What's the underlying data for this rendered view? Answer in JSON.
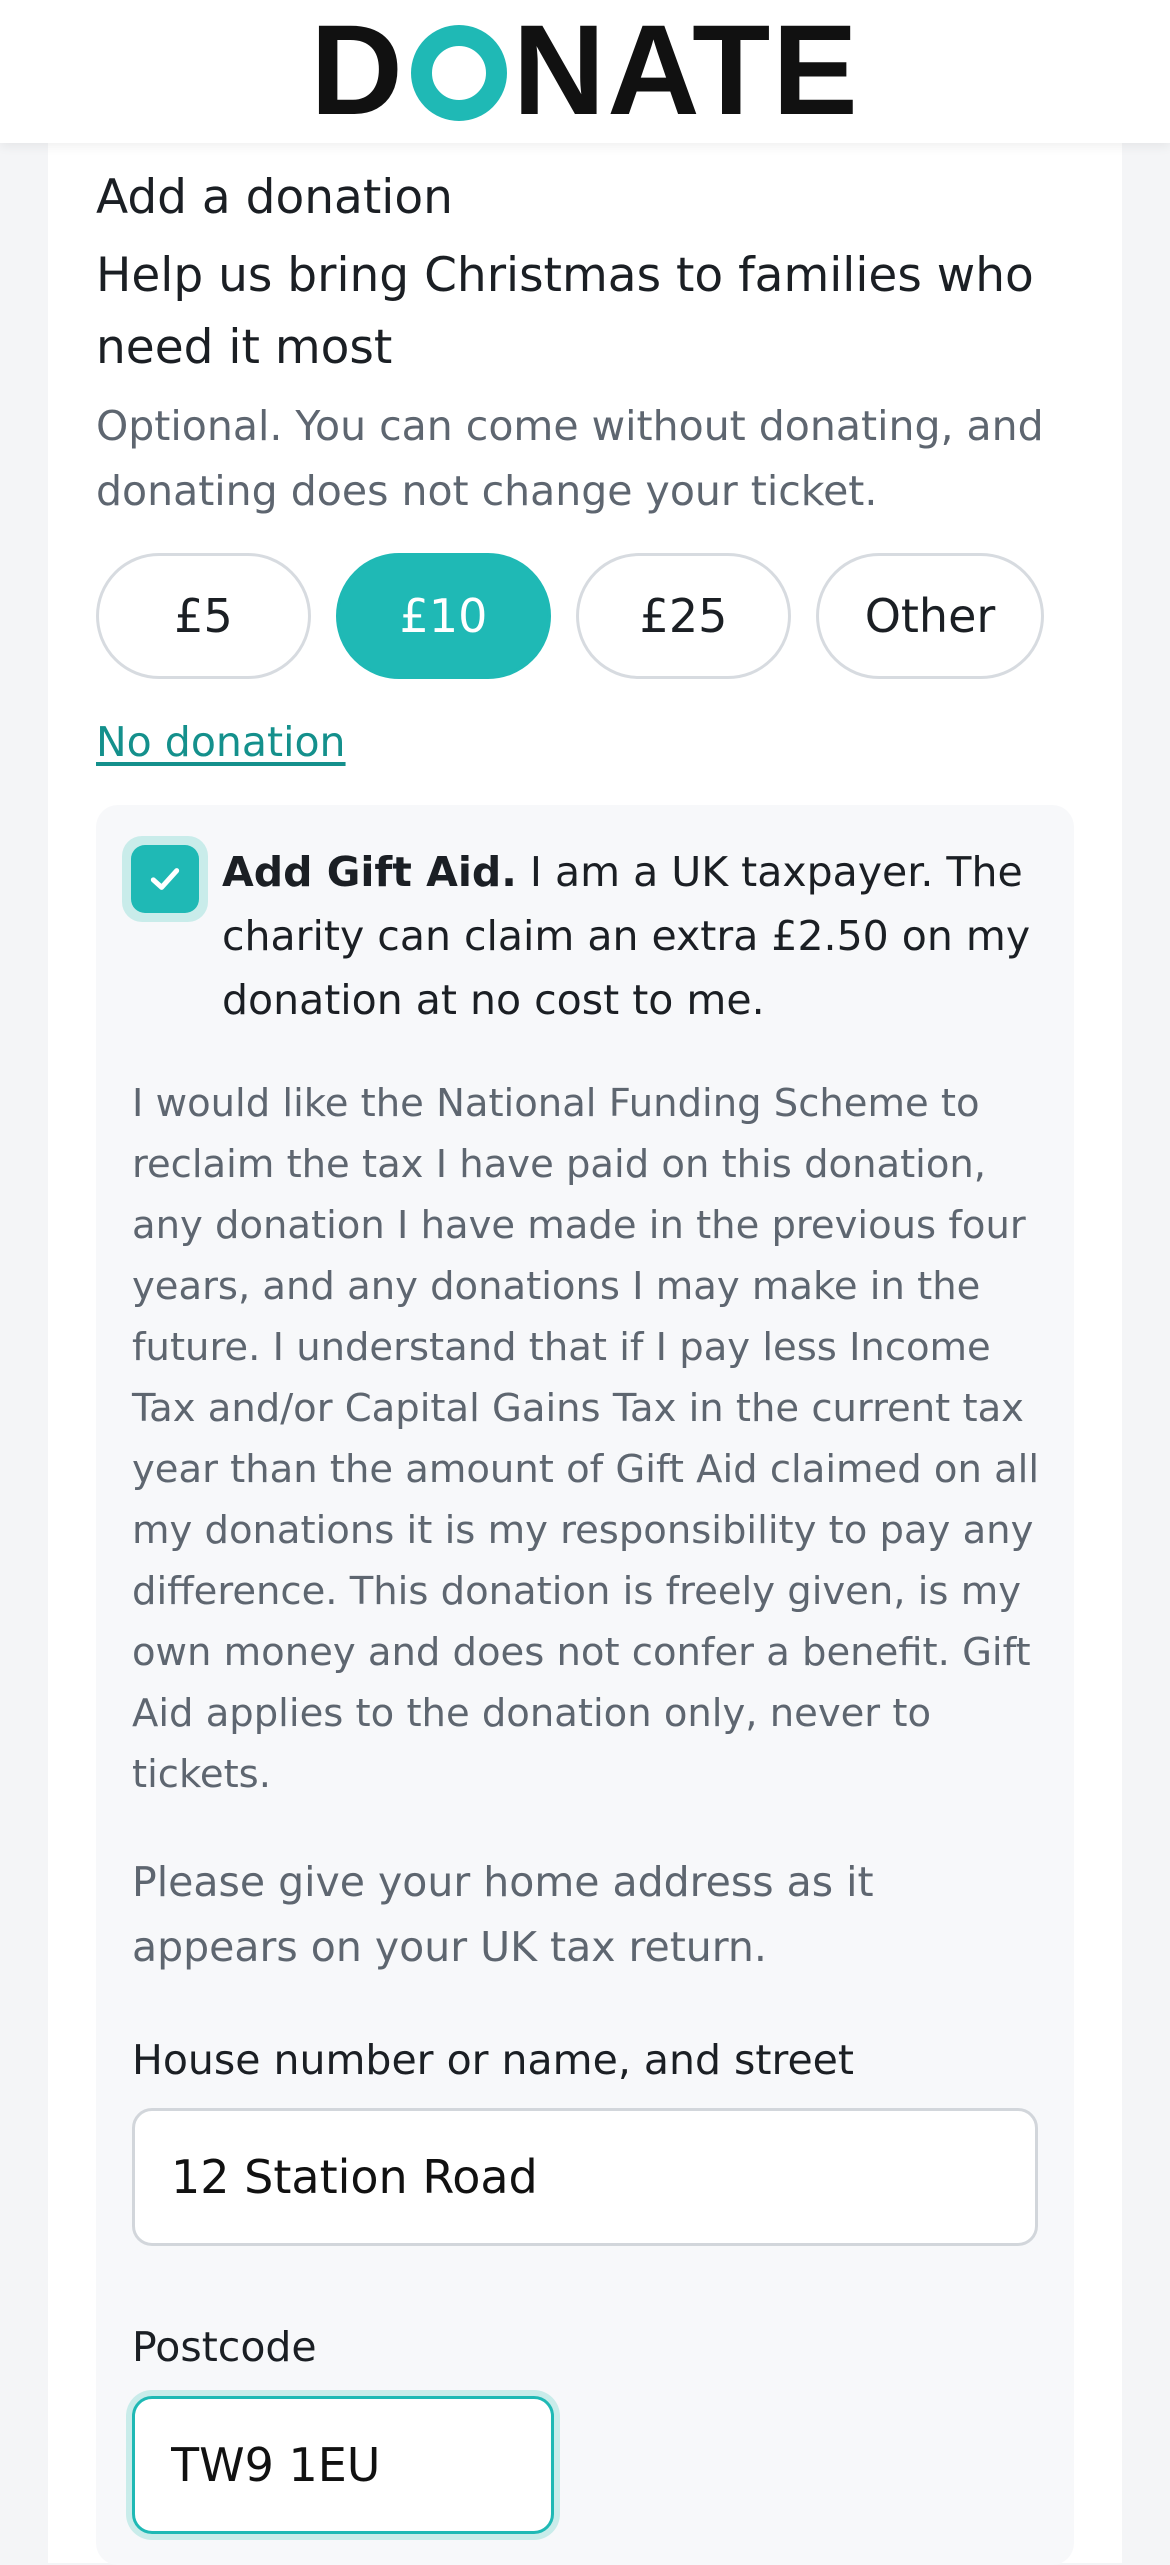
{
  "header": {
    "logo_text": "DONATE"
  },
  "donation": {
    "section_title": "Add a donation",
    "headline": "Help us bring Christmas to families who need it most",
    "optional_note": "Optional. You can come without donating, and donating does not change your ticket.",
    "amounts": [
      {
        "label": "£5",
        "selected": false
      },
      {
        "label": "£10",
        "selected": true
      },
      {
        "label": "£25",
        "selected": false
      },
      {
        "label": "Other",
        "selected": false
      }
    ],
    "no_donation_label": "No donation"
  },
  "gift_aid": {
    "checked": true,
    "label_bold": "Add Gift Aid.",
    "label_rest": " I am a UK taxpayer. The charity can claim an extra £2.50 on my donation at no cost to me.",
    "declaration": "I would like the National Funding Scheme to reclaim the tax I have paid on this donation, any donation I have made in the previous four years, and any donations I may make in the future. I understand that if I pay less Income Tax and/or Capital Gains Tax in the current tax year than the amount of Gift Aid claimed on all my donations it is my responsibility to pay any difference. This donation is freely given, is my own money and does not confer a benefit. Gift Aid applies to the donation only, never to tickets.",
    "address_note": "Please give your home address as it appears on your UK tax return.",
    "street_label": "House number or name, and street",
    "street_value": "12 Station Road",
    "postcode_label": "Postcode",
    "postcode_value": "TW9 1EU"
  },
  "colors": {
    "accent": "#1fb9b5",
    "link": "#14908c",
    "muted_text": "#5e6670"
  },
  "icons": {
    "checkbox": "check-icon"
  }
}
